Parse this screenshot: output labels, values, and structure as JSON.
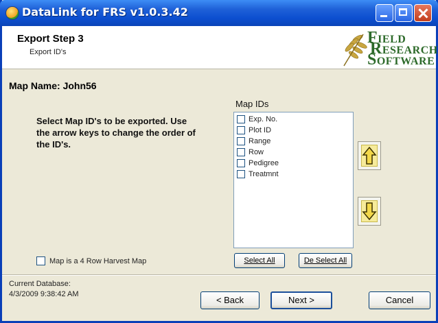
{
  "window": {
    "title": "DataLink for FRS v1.0.3.42"
  },
  "header": {
    "step_title": "Export Step 3",
    "step_subtitle": "Export ID's",
    "logo": {
      "line1_initial": "F",
      "line1_rest": "IELD",
      "line2_initial": "R",
      "line2_rest": "ESEARCH",
      "line3_initial": "S",
      "line3_rest": "OFTWARE"
    }
  },
  "main": {
    "map_name": "Map Name: John56",
    "instructions": "Select Map ID's to be exported. Use the arrow keys to change the order of the ID's.",
    "map_ids_label": "Map IDs",
    "map_ids": [
      {
        "label": "Exp. No.",
        "checked": false
      },
      {
        "label": "Plot ID",
        "checked": false
      },
      {
        "label": "Range",
        "checked": false
      },
      {
        "label": "Row",
        "checked": false
      },
      {
        "label": "Pedigree",
        "checked": false
      },
      {
        "label": "Treatmnt",
        "checked": false
      }
    ],
    "harvest_checkbox_label": "Map is a 4 Row Harvest Map",
    "select_all_label": "Select All",
    "deselect_all_label": "De Select All"
  },
  "footer": {
    "current_db_label": "Current Database:",
    "current_db_time": "4/3/2009 9:38:42 AM",
    "back_label": "< Back",
    "next_label": "Next >",
    "cancel_label": "Cancel"
  },
  "colors": {
    "title_bar": "#0c4fd0",
    "arrow_fill": "#f6eb9b",
    "logo_green": "#2d6a2a"
  }
}
